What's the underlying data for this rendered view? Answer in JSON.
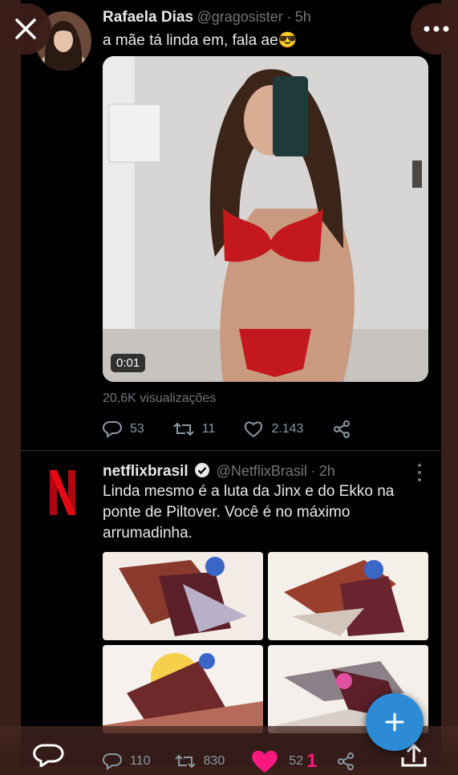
{
  "tweet1": {
    "display_name": "Rafaela Dias",
    "handle": "@gragosister",
    "separator": "·",
    "time": "5h",
    "text": "a mãe tá linda em, fala ae😎",
    "video_time": "0:01",
    "views": "20,6K visualizações",
    "replies": "53",
    "retweets": "11",
    "likes": "2.143"
  },
  "tweet2": {
    "display_name": "netflixbrasil",
    "handle": "@NetflixBrasil",
    "separator": "·",
    "time": "2h",
    "text": "Linda mesmo é a luta da Jinx e do Ekko na ponte de Piltover. Você é no máximo arrumadinha.",
    "replies": "110",
    "retweets": "830",
    "likes": "52"
  },
  "bottom_bar": {
    "partial_count": "1"
  },
  "colors": {
    "background": "#000000",
    "frame_border": "#3a1f1a",
    "text_primary": "#e7e9ea",
    "text_muted": "#71767b",
    "fab": "#2d8bd6",
    "like_pink": "#f91880",
    "netflix_red": "#e50914"
  },
  "icons": [
    "close-icon",
    "more-icon",
    "reply-icon",
    "retweet-icon",
    "like-icon",
    "share-icon",
    "verified-icon",
    "plus-icon"
  ]
}
